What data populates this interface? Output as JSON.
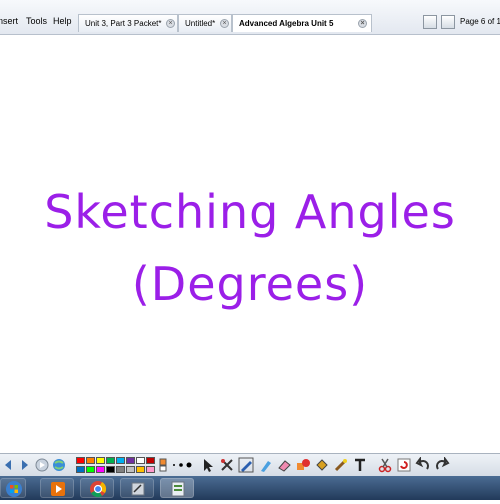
{
  "menu": {
    "items": [
      {
        "label": "nsert",
        "access_key": ""
      },
      {
        "label": "Tools",
        "access_key": "T"
      },
      {
        "label": "Help",
        "access_key": "H"
      }
    ]
  },
  "tabs": [
    {
      "label": "Unit 3, Part 3 Packet*",
      "active": false
    },
    {
      "label": "Untitled*",
      "active": false
    },
    {
      "label": "Advanced Algebra Unit 5",
      "active": true
    }
  ],
  "page_indicator": "Page 6 of 1",
  "slide": {
    "line1": "Sketching Angles",
    "line2": "(Degrees)",
    "color": "#9b1fe8"
  },
  "palette": {
    "colors": [
      "#ff0000",
      "#ff7f00",
      "#ffff00",
      "#00b050",
      "#00b0f0",
      "#7030a0",
      "#ffffff",
      "#c00000",
      "#0070c0",
      "#00ff00",
      "#ff00ff",
      "#000000",
      "#808080",
      "#c0c0c0",
      "#ffc000",
      "#ff99cc"
    ]
  },
  "tools": [
    {
      "icon": "select-arrow-icon"
    },
    {
      "icon": "multi-tool-icon"
    },
    {
      "icon": "pen-icon"
    },
    {
      "icon": "highlighter-icon"
    },
    {
      "icon": "eraser-icon"
    },
    {
      "icon": "shapes-icon"
    },
    {
      "icon": "fill-icon"
    },
    {
      "icon": "magic-pen-icon"
    },
    {
      "icon": "text-icon"
    },
    {
      "icon": "scissors-icon"
    },
    {
      "icon": "refresh-icon"
    },
    {
      "icon": "undo-icon"
    },
    {
      "icon": "redo-icon"
    }
  ],
  "taskbar": [
    {
      "icon": "windows-start-icon"
    },
    {
      "icon": "media-player-icon"
    },
    {
      "icon": "chrome-icon"
    },
    {
      "icon": "app-icon"
    },
    {
      "icon": "smart-notebook-icon"
    }
  ]
}
